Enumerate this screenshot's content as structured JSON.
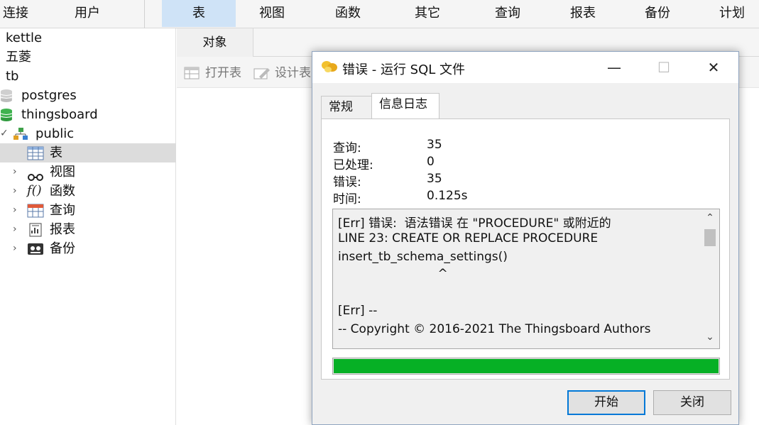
{
  "toolbar": {
    "items": [
      "连接",
      "用户",
      "表",
      "视图",
      "函数",
      "其它",
      "查询",
      "报表",
      "备份",
      "计划"
    ],
    "active": "表"
  },
  "sidebar": {
    "items": [
      {
        "label": "kettle",
        "icon": "none"
      },
      {
        "label": "五菱",
        "icon": "none"
      },
      {
        "label": "tb",
        "icon": "none"
      },
      {
        "label": "postgres",
        "icon": "database-gray-icon"
      },
      {
        "label": "thingsboard",
        "icon": "database-green-icon"
      },
      {
        "label": "public",
        "icon": "schema-icon",
        "expanded": true
      },
      {
        "label": "表",
        "icon": "table-icon",
        "selected": true
      },
      {
        "label": "视图",
        "icon": "glasses-icon"
      },
      {
        "label": "函数",
        "icon": "function-icon"
      },
      {
        "label": "查询",
        "icon": "query-icon"
      },
      {
        "label": "报表",
        "icon": "report-icon"
      },
      {
        "label": "备份",
        "icon": "backup-icon"
      }
    ]
  },
  "main": {
    "tab_label": "对象",
    "tools": {
      "open_table": "打开表",
      "design_table": "设计表"
    }
  },
  "dialog": {
    "title": "错误 - 运行 SQL 文件",
    "tabs": [
      "常规",
      "信息日志"
    ],
    "active_tab": "信息日志",
    "stats": {
      "query_label": "查询:",
      "query_value": "35",
      "processed_label": "已处理:",
      "processed_value": "0",
      "error_label": "错误:",
      "error_value": "35",
      "time_label": "时间:",
      "time_value": "0.125s"
    },
    "log_lines": [
      "[Err] 错误:  语法错误 在 \"PROCEDURE\" 或附近的",
      "LINE 23: CREATE OR REPLACE PROCEDURE",
      "insert_tb_schema_settings()",
      "                          ^",
      "",
      "[Err] --",
      "-- Copyright © 2016-2021 The Thingsboard Authors"
    ],
    "progress": 1.0,
    "buttons": {
      "start": "开始",
      "close": "关闭"
    },
    "colors": {
      "progress": "#06b025",
      "default_button_border": "#0078d7"
    }
  }
}
